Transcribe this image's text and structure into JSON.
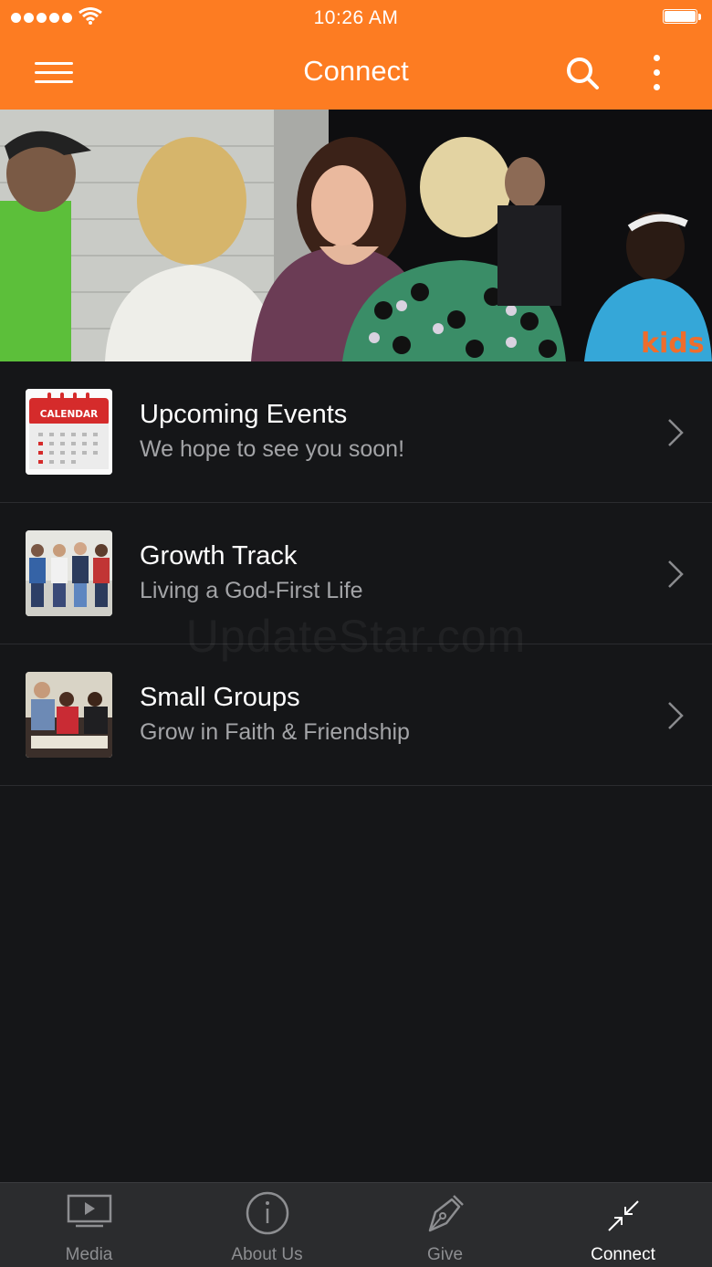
{
  "status_bar": {
    "time": "10:26 AM"
  },
  "header": {
    "title": "Connect",
    "accent_color": "#fd7c22"
  },
  "list": {
    "items": [
      {
        "title": "Upcoming Events",
        "subtitle": "We hope to see you soon!",
        "thumb_icon": "calendar-icon",
        "thumb_label": "CALENDAR"
      },
      {
        "title": "Growth Track",
        "subtitle": "Living a God-First Life",
        "thumb_icon": "group-photo"
      },
      {
        "title": "Small Groups",
        "subtitle": "Grow in Faith & Friendship",
        "thumb_icon": "small-group-photo"
      }
    ]
  },
  "hero": {
    "shirt_text": "kids"
  },
  "watermark": "UpdateStar.com",
  "tabs": [
    {
      "label": "Media",
      "icon": "play-screen-icon",
      "active": false
    },
    {
      "label": "About Us",
      "icon": "info-icon",
      "active": false
    },
    {
      "label": "Give",
      "icon": "pen-nib-icon",
      "active": false
    },
    {
      "label": "Connect",
      "icon": "arrows-inward-icon",
      "active": true
    }
  ]
}
